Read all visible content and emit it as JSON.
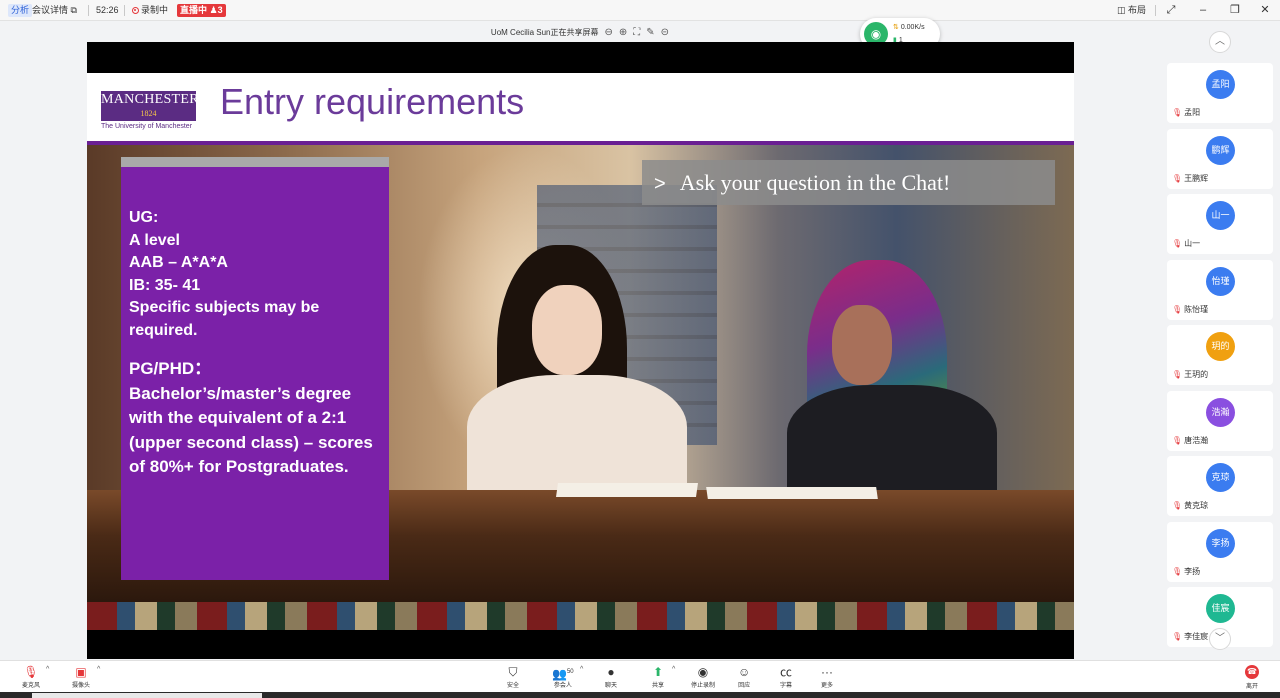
{
  "topbar": {
    "group_tag": "分析",
    "meeting_details": "会议详情",
    "timer": "52:26",
    "recording": "录制中",
    "live_tag": "直播中",
    "live_count": "3",
    "layout": "布局"
  },
  "share_bar": {
    "title": "UoM Cecilia Sun正在共享屏幕"
  },
  "network": {
    "upload": "0.00K/s",
    "download": "1"
  },
  "slide": {
    "logo_main": "MANCHESTER",
    "logo_year": "1824",
    "logo_sub": "The University of Manchester",
    "title": "Entry requirements",
    "chat_banner": "Ask your question in the Chat!",
    "ug_lines": [
      "UG:",
      "A level",
      "AAB – A*A*A",
      "IB: 35- 41",
      "Specific subjects may be",
      "required."
    ],
    "pg_lines": [
      "PG/PHD：",
      "Bachelor’s/master’s degree",
      "with the equivalent of a 2:1",
      "(upper second class) – scores",
      "of 80%+ for Postgraduates."
    ]
  },
  "participants": [
    {
      "avatar": "孟阳",
      "name": "孟阳",
      "color": "#3b7cf0"
    },
    {
      "avatar": "鹏辉",
      "name": "王鹏辉",
      "color": "#3b7cf0"
    },
    {
      "avatar": "山一",
      "name": "山一",
      "color": "#3b7cf0"
    },
    {
      "avatar": "怡瑾",
      "name": "陈怡瑾",
      "color": "#3b7cf0"
    },
    {
      "avatar": "玥的",
      "name": "王玥的",
      "color": "#f0a010"
    },
    {
      "avatar": "浩瀚",
      "name": "唐浩瀚",
      "color": "#8a4fe0"
    },
    {
      "avatar": "克琼",
      "name": "黄克琼",
      "color": "#3b7cf0"
    },
    {
      "avatar": "李扬",
      "name": "李扬",
      "color": "#3b7cf0"
    },
    {
      "avatar": "佳宸",
      "name": "李佳宸",
      "color": "#1fb892"
    }
  ],
  "toolbar": {
    "mic": "麦克风",
    "camera": "摄像头",
    "security": "安全",
    "participants": "参会人",
    "participants_count": "50",
    "chat": "聊天",
    "share": "共享",
    "stop_recording": "停止录制",
    "reactions": "回应",
    "captions": "字幕",
    "more": "更多",
    "leave": "离开"
  }
}
